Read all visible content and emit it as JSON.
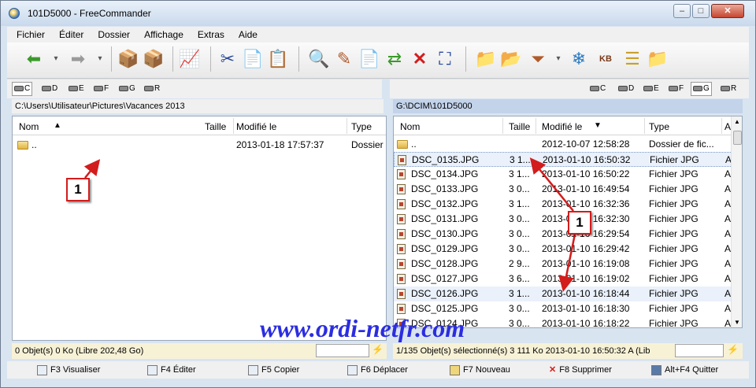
{
  "window": {
    "title": "101D5000 - FreeCommander"
  },
  "menu": [
    "Fichier",
    "Éditer",
    "Dossier",
    "Affichage",
    "Extras",
    "Aide"
  ],
  "left": {
    "drives": [
      "C",
      "D",
      "E",
      "F",
      "G",
      "R"
    ],
    "path": "C:\\Users\\Utilisateur\\Pictures\\Vacances 2013",
    "columns": {
      "name": "Nom",
      "size": "Taille",
      "modified": "Modifié le",
      "type": "Type"
    },
    "rows": [
      {
        "name": "..",
        "size": "",
        "modified": "2013-01-18 17:57:37",
        "type": "Dossier"
      }
    ],
    "status": "0 Objet(s)  0 Ko    (Libre 202,48 Go)"
  },
  "right": {
    "drives": [
      "C",
      "D",
      "E",
      "F",
      "G",
      "R"
    ],
    "path": "G:\\DCIM\\101D5000",
    "columns": {
      "name": "Nom",
      "size": "Taille",
      "modified": "Modifié le",
      "type": "Type",
      "attr": "A"
    },
    "rows": [
      {
        "name": "..",
        "size": "",
        "modified": "2012-10-07 12:58:28",
        "type": "Dossier de fic...",
        "attr": ""
      },
      {
        "name": "DSC_0135.JPG",
        "size": "3 1...",
        "modified": "2013-01-10 16:50:32",
        "type": "Fichier JPG",
        "attr": "A"
      },
      {
        "name": "DSC_0134.JPG",
        "size": "3 1...",
        "modified": "2013-01-10 16:50:22",
        "type": "Fichier JPG",
        "attr": "A"
      },
      {
        "name": "DSC_0133.JPG",
        "size": "3 0...",
        "modified": "2013-01-10 16:49:54",
        "type": "Fichier JPG",
        "attr": "A"
      },
      {
        "name": "DSC_0132.JPG",
        "size": "3 1...",
        "modified": "2013-01-10 16:32:36",
        "type": "Fichier JPG",
        "attr": "A"
      },
      {
        "name": "DSC_0131.JPG",
        "size": "3 0...",
        "modified": "2013-01-10 16:32:30",
        "type": "Fichier JPG",
        "attr": "A"
      },
      {
        "name": "DSC_0130.JPG",
        "size": "3 0...",
        "modified": "2013-01-10 16:29:54",
        "type": "Fichier JPG",
        "attr": "A"
      },
      {
        "name": "DSC_0129.JPG",
        "size": "3 0...",
        "modified": "2013-01-10 16:29:42",
        "type": "Fichier JPG",
        "attr": "A"
      },
      {
        "name": "DSC_0128.JPG",
        "size": "2 9...",
        "modified": "2013-01-10 16:19:08",
        "type": "Fichier JPG",
        "attr": "A"
      },
      {
        "name": "DSC_0127.JPG",
        "size": "3 6...",
        "modified": "2013-01-10 16:19:02",
        "type": "Fichier JPG",
        "attr": "A"
      },
      {
        "name": "DSC_0126.JPG",
        "size": "3 1...",
        "modified": "2013-01-10 16:18:44",
        "type": "Fichier JPG",
        "attr": "A"
      },
      {
        "name": "DSC_0125.JPG",
        "size": "3 0...",
        "modified": "2013-01-10 16:18:30",
        "type": "Fichier JPG",
        "attr": "A"
      },
      {
        "name": "DSC_0124.JPG",
        "size": "3 0...",
        "modified": "2013-01-10 16:18:22",
        "type": "Fichier JPG",
        "attr": "A"
      }
    ],
    "status": "1/135 Objet(s) sélectionné(s)   3 111 Ko   2013-01-10 16:50:32  A   (Lib"
  },
  "fkeys": [
    "F3 Visualiser",
    "F4 Éditer",
    "F5 Copier",
    "F6 Déplacer",
    "F7 Nouveau",
    "F8 Supprimer",
    "Alt+F4 Quitter"
  ],
  "callouts": [
    "1",
    "1"
  ],
  "watermark": "www.ordi-netfr.com",
  "colors": {
    "accent": "#d31c1c",
    "selection_path": "#c3d3ea",
    "status_bg": "#f7f2d6",
    "watermark": "#2b2de0"
  }
}
